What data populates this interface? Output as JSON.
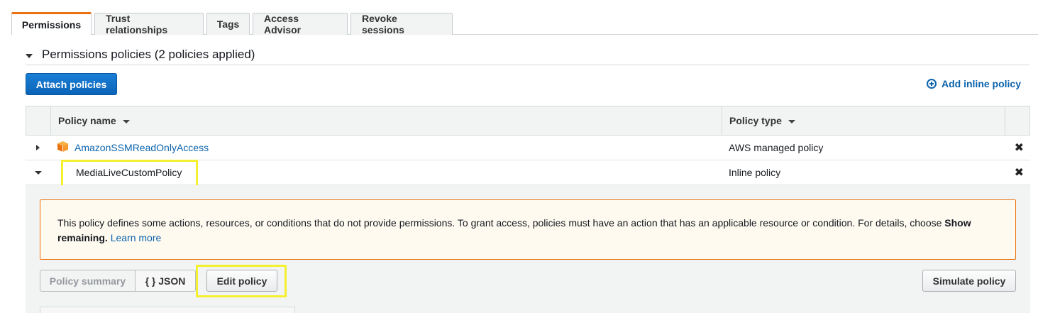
{
  "tabs": [
    {
      "label": "Permissions",
      "active": true
    },
    {
      "label": "Trust relationships",
      "active": false
    },
    {
      "label": "Tags",
      "active": false
    },
    {
      "label": "Access Advisor",
      "active": false
    },
    {
      "label": "Revoke sessions",
      "active": false
    }
  ],
  "section": {
    "title": "Permissions policies (2 policies applied)"
  },
  "toolbar": {
    "attach_label": "Attach policies",
    "add_inline_label": "Add inline policy"
  },
  "table": {
    "columns": [
      "Policy name",
      "Policy type"
    ],
    "rows": [
      {
        "name": "AmazonSSMReadOnlyAccess",
        "type": "AWS managed policy",
        "expanded": false,
        "is_link": true
      },
      {
        "name": "MediaLiveCustomPolicy",
        "type": "Inline policy",
        "expanded": true,
        "is_link": false
      }
    ],
    "remove_glyph": "✖"
  },
  "details": {
    "warning_text": "This policy defines some actions, resources, or conditions that do not provide permissions. To grant access, policies must have an action that has an applicable resource or condition. For details, choose ",
    "warning_bold": "Show remaining.",
    "learn_more": "Learn more",
    "policy_summary_label": "Policy summary",
    "json_label": "{ } JSON",
    "edit_policy_label": "Edit policy",
    "simulate_label": "Simulate policy"
  },
  "colors": {
    "active_tab_accent": "#ec7211",
    "primary_button": "#0b64b8",
    "link": "#0b63ac",
    "highlight": "#f4f030",
    "warning_border": "#ec7211"
  },
  "icons": {
    "aws_managed": "aws-box-icon",
    "remove": "close-icon",
    "add_inline": "plus-circle-icon"
  }
}
